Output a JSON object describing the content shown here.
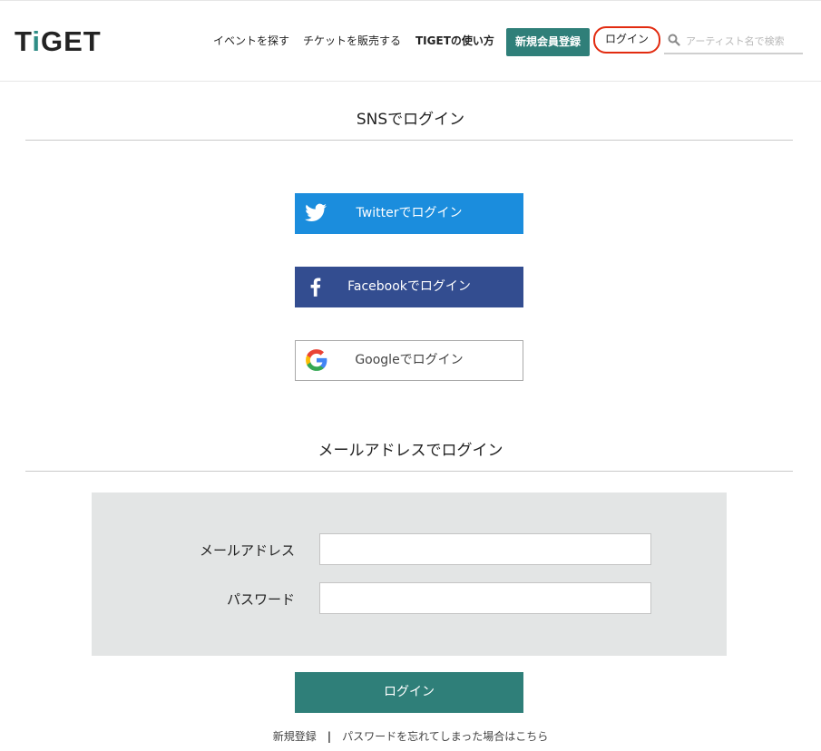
{
  "header": {
    "logo": "TiGET",
    "nav": {
      "find_events": "イベントを探す",
      "sell_tickets": "チケットを販売する",
      "how_to_use": "TIGETの使い方",
      "register": "新規会員登録",
      "login": "ログイン"
    },
    "search": {
      "placeholder": "アーティスト名で検索",
      "icon": "search-icon"
    }
  },
  "sns_section": {
    "title": "SNSでログイン",
    "buttons": [
      {
        "label": "Twitterでログイン",
        "icon": "twitter-bird-icon",
        "color": "#1b8ddd"
      },
      {
        "label": "Facebookでログイン",
        "icon": "facebook-f-icon",
        "color": "#334d90"
      },
      {
        "label": "Googleでログイン",
        "icon": "google-g-icon",
        "color": "#ffffff"
      }
    ]
  },
  "email_section": {
    "title": "メールアドレスでログイン",
    "email_label": "メールアドレス",
    "email_value": "",
    "password_label": "パスワード",
    "password_value": "",
    "submit_label": "ログイン"
  },
  "footer_links": {
    "register": "新規登録",
    "separator": "|",
    "forgot_password": "パスワードを忘れてしまった場合はこちら"
  },
  "colors": {
    "accent": "#2f7f79",
    "twitter": "#1b8ddd",
    "facebook": "#334d90",
    "highlight_ring": "#e22b10"
  }
}
